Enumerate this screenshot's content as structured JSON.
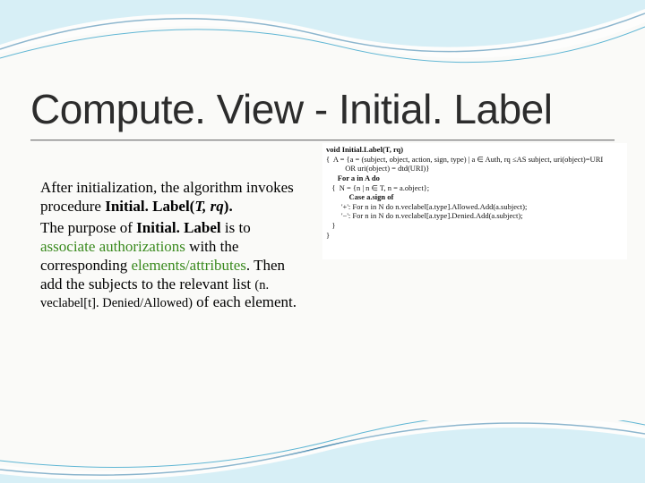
{
  "title": "Compute. View - Initial. Label",
  "body": {
    "p1a": "After initialization, the algorithm invokes procedure ",
    "p1b": "Initial. Label(",
    "p1c": "T, rq",
    "p1d": ").",
    "p2a": "The purpose of ",
    "p2b": "Initial. Label",
    "p2c": " is to ",
    "p2d": "associate authorizations",
    "p2e": " with the corresponding ",
    "p2f": "elements/attributes",
    "p2g": ". Then add the subjects to the relevant list ",
    "p2h": "(n. veclabel[t]. Denied/Allowed)",
    "p2i": " of each element."
  },
  "pseudocode": {
    "l1": "void Initial.Label(T, rq)",
    "l2": "{  A = {a = (subject, object, action, sign, type) | a ∈ Auth, rq ≤AS subject, uri(object)=URI",
    "l3": "          OR uri(object) = dtd(URI)}",
    "l4": "   For a in A do",
    "l5": "   {  N = {n | n ∈ T, n = a.object};",
    "l6": "      Case a.sign of",
    "l7": "        '+': For n in N do n.veclabel[a.type].Allowed.Add(a.subject);",
    "l8": "        '−': For n in N do n.veclabel[a.type].Denied.Add(a.subject);",
    "l9": "   }",
    "l10": "}"
  },
  "colors": {
    "accent_green": "#3a8a1e",
    "curve_dark": "#1a6c9c",
    "curve_light": "#8fd3e8"
  }
}
